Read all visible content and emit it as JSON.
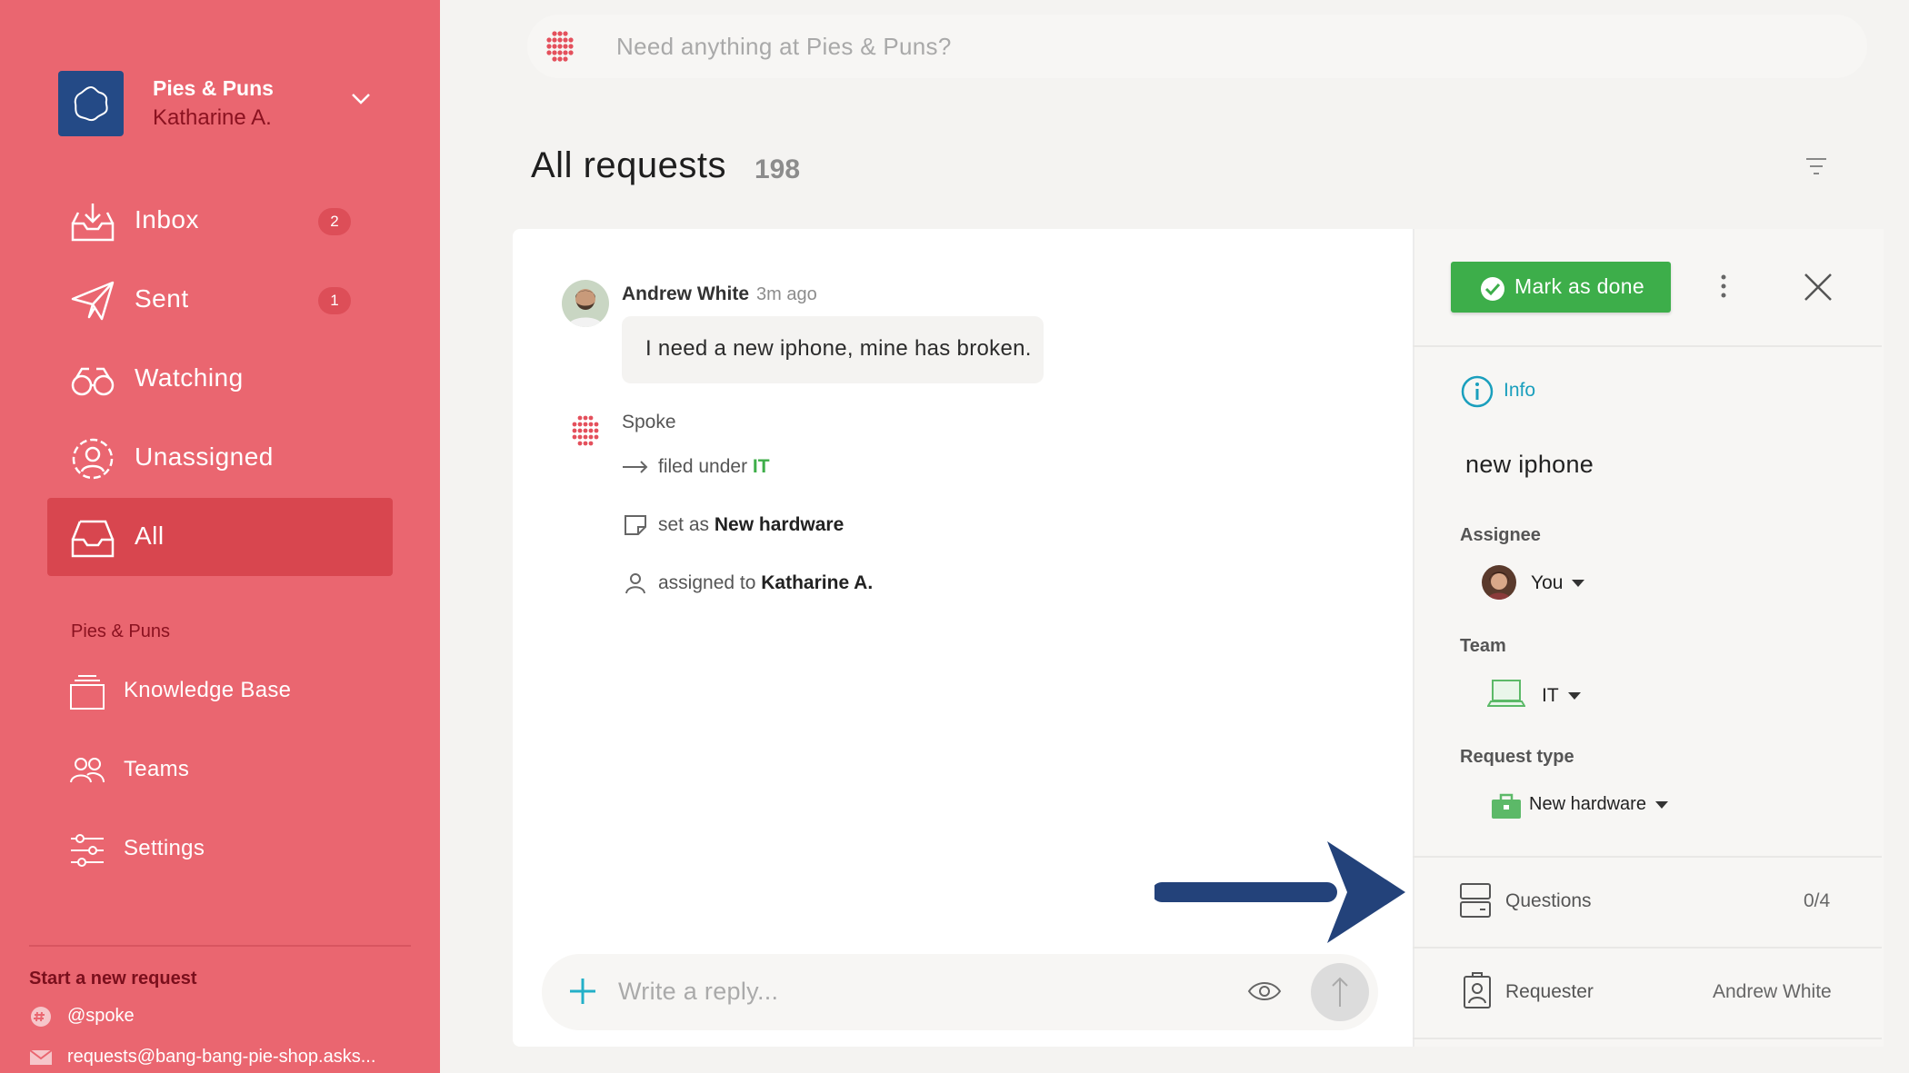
{
  "workspace": {
    "name": "Pies & Puns",
    "user": "Katharine A."
  },
  "nav": [
    {
      "label": "Inbox",
      "badge": "2",
      "icon": "inbox-icon"
    },
    {
      "label": "Sent",
      "badge": "1",
      "icon": "paper-plane-icon"
    },
    {
      "label": "Watching",
      "badge": "",
      "icon": "binoculars-icon"
    },
    {
      "label": "Unassigned",
      "badge": "",
      "icon": "user-circle-icon"
    },
    {
      "label": "All",
      "badge": "",
      "icon": "tray-icon"
    }
  ],
  "section_label": "Pies & Puns",
  "sub_nav": [
    {
      "label": "Knowledge Base",
      "icon": "book-stack-icon"
    },
    {
      "label": "Teams",
      "icon": "people-icon"
    },
    {
      "label": "Settings",
      "icon": "sliders-icon"
    }
  ],
  "start_request": {
    "heading": "Start a new request",
    "slack": "@spoke",
    "email": "requests@bang-bang-pie-shop.asks..."
  },
  "search": {
    "placeholder": "Need anything at Pies & Puns?"
  },
  "header": {
    "title": "All requests",
    "count": "198"
  },
  "message": {
    "author": "Andrew White",
    "time": "3m ago",
    "text": "I need a new iphone, mine has broken."
  },
  "bot": {
    "name": "Spoke",
    "filed_prefix": "filed under",
    "filed_value": "IT",
    "set_prefix": "set as",
    "set_value": "New hardware",
    "assigned_prefix": "assigned to",
    "assigned_value": "Katharine A."
  },
  "reply": {
    "placeholder": "Write a reply..."
  },
  "panel": {
    "done_label": "Mark as done",
    "info_label": "Info",
    "request_title": "new iphone",
    "assignee_label": "Assignee",
    "assignee_value": "You",
    "team_label": "Team",
    "team_value": "IT",
    "type_label": "Request type",
    "type_value": "New hardware",
    "questions_label": "Questions",
    "questions_value": "0/4",
    "requester_label": "Requester",
    "requester_value": "Andrew White"
  },
  "colors": {
    "sidebar": "#ea6670",
    "active_nav": "#d8464f",
    "accent_green": "#3dae4a",
    "info_blue": "#1a9fbd",
    "arrow": "#23427a"
  }
}
